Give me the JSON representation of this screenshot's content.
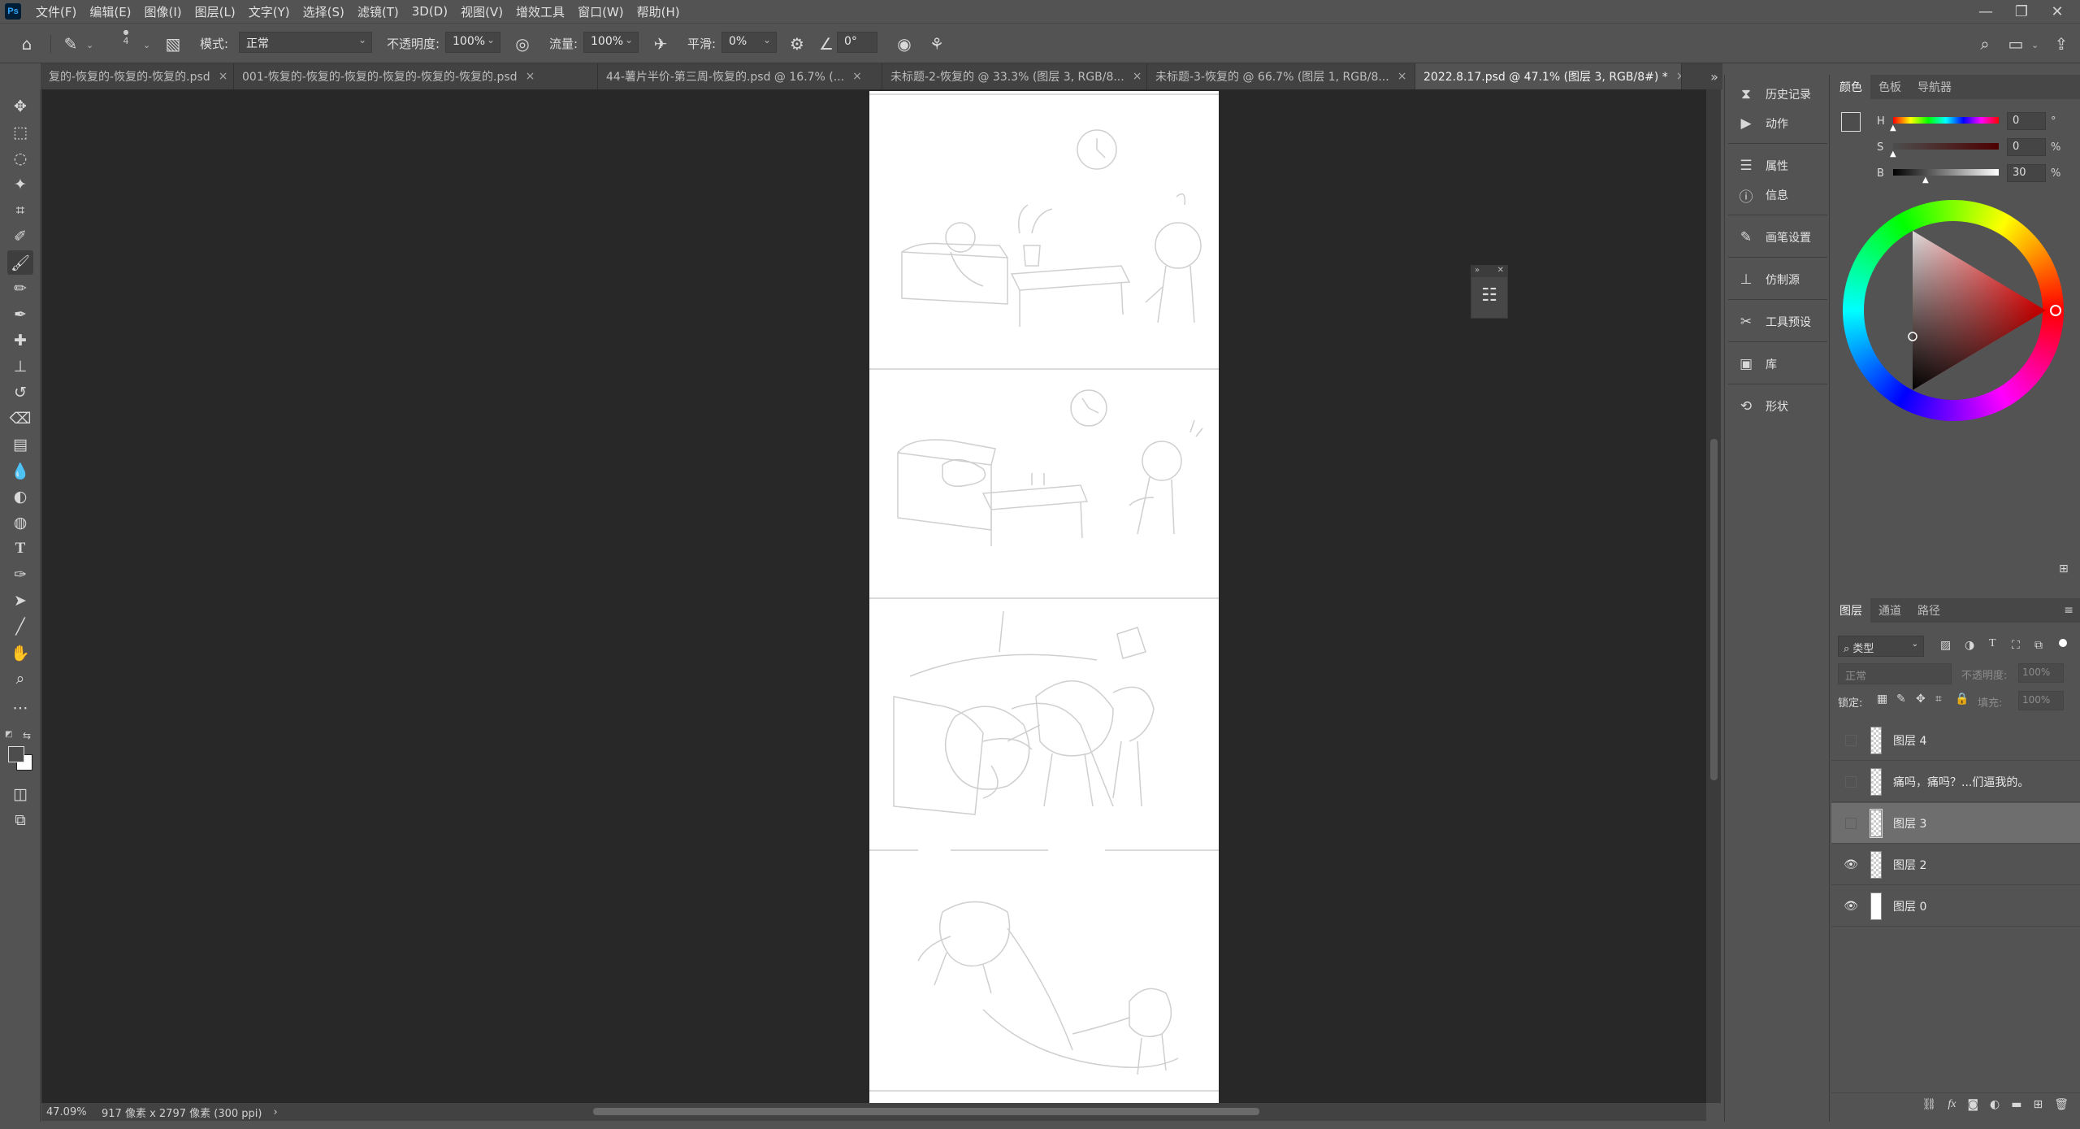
{
  "menu": {
    "logo": "Ps",
    "items": [
      "文件(F)",
      "编辑(E)",
      "图像(I)",
      "图层(L)",
      "文字(Y)",
      "选择(S)",
      "滤镜(T)",
      "3D(D)",
      "视图(V)",
      "增效工具",
      "窗口(W)",
      "帮助(H)"
    ]
  },
  "window_controls": {
    "minimize": "—",
    "restore": "❐",
    "close": "✕"
  },
  "options": {
    "brush_size": "4",
    "mode_label": "模式:",
    "mode_value": "正常",
    "opacity_label": "不透明度:",
    "opacity_value": "100%",
    "flow_label": "流量:",
    "flow_value": "100%",
    "smoothing_label": "平滑:",
    "smoothing_value": "0%",
    "angle_value": "0°"
  },
  "tabs": [
    {
      "label": "复的-恢复的-恢复的-恢复的.psd",
      "close": "×"
    },
    {
      "label": "001-恢复的-恢复的-恢复的-恢复的-恢复的-恢复的.psd",
      "close": "×"
    },
    {
      "label": "44-薯片半价-第三周-恢复的.psd @ 16.7% (...",
      "close": "×"
    },
    {
      "label": "未标题-2-恢复的 @ 33.3% (图层 3, RGB/8...",
      "close": "×"
    },
    {
      "label": "未标题-3-恢复的 @ 66.7% (图层 1, RGB/8...",
      "close": "×"
    },
    {
      "label": "2022.8.17.psd @ 47.1% (图层 3, RGB/8#) *",
      "close": "×"
    }
  ],
  "tabs_overflow": "»",
  "status": {
    "zoom": "47.09%",
    "doc_info": "917 像素 x 2797 像素 (300 ppi)",
    "arrow": "›"
  },
  "panel_strip": {
    "items": [
      "历史记录",
      "动作",
      "属性",
      "信息",
      "画笔设置",
      "仿制源",
      "工具预设",
      "库",
      "形状"
    ]
  },
  "color_panel": {
    "tabs": [
      "颜色",
      "色板",
      "导航器"
    ],
    "h_label": "H",
    "h_value": "0",
    "h_unit": "°",
    "s_label": "S",
    "s_value": "0",
    "s_unit": "%",
    "b_label": "B",
    "b_value": "30",
    "b_unit": "%"
  },
  "layers_panel": {
    "tabs": [
      "图层",
      "通道",
      "路径"
    ],
    "filter_kind": "类型",
    "blend_mode": "正常",
    "opacity_label": "不透明度:",
    "opacity_value": "100%",
    "lock_label": "锁定:",
    "fill_label": "填充:",
    "fill_value": "100%",
    "layers": [
      {
        "name": "图层 4",
        "visible": false,
        "selected": false
      },
      {
        "name": "痛吗，痛吗？...们逼我的。",
        "visible": false,
        "selected": false
      },
      {
        "name": "图层 3",
        "visible": false,
        "selected": true
      },
      {
        "name": "图层 2",
        "visible": true,
        "selected": false
      },
      {
        "name": "图层 0",
        "visible": true,
        "selected": false
      }
    ],
    "bottom_icons": [
      "link-icon",
      "fx-icon",
      "mask-icon",
      "adjustment-icon",
      "folder-icon",
      "new-layer-icon",
      "trash-icon"
    ],
    "fx_label": "fx"
  },
  "colors": {
    "workspace": "#282828",
    "panel": "#535353",
    "accent": "#31a8ff"
  }
}
